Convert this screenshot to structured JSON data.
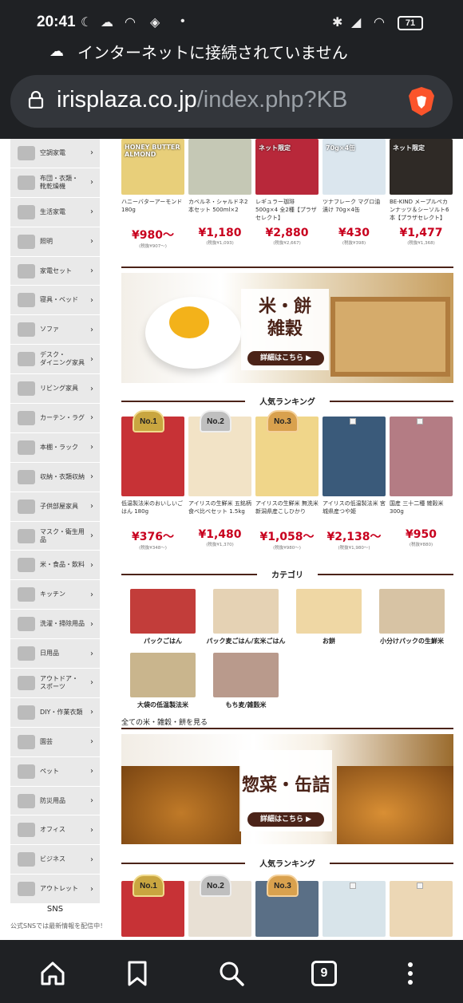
{
  "status_bar": {
    "time": "20:41",
    "dot": "•",
    "battery": "71"
  },
  "offline_banner": {
    "text": "インターネットに接続されていません"
  },
  "address_bar": {
    "domain": "irisplaza.co.jp",
    "path": "/index.php?KB"
  },
  "sidebar": {
    "items": [
      {
        "label": "空調家電"
      },
      {
        "label": "布団・衣類・\n靴乾燥機"
      },
      {
        "label": "生活家電"
      },
      {
        "label": "照明"
      },
      {
        "label": "家電セット"
      },
      {
        "label": "寝具・ベッド"
      },
      {
        "label": "ソファ"
      },
      {
        "label": "デスク・\nダイニング家具"
      },
      {
        "label": "リビング家具"
      },
      {
        "label": "カーテン・ラグ"
      },
      {
        "label": "本棚・ラック"
      },
      {
        "label": "収納・衣類収納"
      },
      {
        "label": "子供部屋家具"
      },
      {
        "label": "マスク・衛生用品"
      },
      {
        "label": "米・食品・飲料"
      },
      {
        "label": "キッチン"
      },
      {
        "label": "洗濯・掃除用品"
      },
      {
        "label": "日用品"
      },
      {
        "label": "アウトドア・\nスポーツ"
      },
      {
        "label": "DIY・作業衣類"
      },
      {
        "label": "園芸"
      },
      {
        "label": "ペット"
      },
      {
        "label": "防災用品"
      },
      {
        "label": "オフィス"
      },
      {
        "label": "ビジネス"
      },
      {
        "label": "アウトレット"
      }
    ],
    "arrow": "›"
  },
  "sns": {
    "title": "SNS",
    "subtitle": "公式SNSでは最新情報を配信中！"
  },
  "top_products": [
    {
      "name": "ハニーバターアーモンド 180g",
      "price": "¥980〜",
      "tax": "(税抜¥907〜)",
      "img_text": "HONEY BUTTER ALMOND"
    },
    {
      "name": "カベルネ・シャルドネ2本セット 500ml×2",
      "price": "¥1,180",
      "tax": "(税抜¥1,093)",
      "img_text": ""
    },
    {
      "name": "レギュラー珈琲 500g×4 全2種【プラザセレクト】",
      "price": "¥2,880",
      "tax": "(税抜¥2,667)",
      "img_text": "ネット限定"
    },
    {
      "name": "ツナフレーク マグロ油漬け 70g×4缶",
      "price": "¥430",
      "tax": "(税抜¥398)",
      "img_text": "70g×4缶"
    },
    {
      "name": "BE-KIND メープルペカンナッツ＆シーソルト6本【プラザセレクト】",
      "price": "¥1,477",
      "tax": "(税抜¥1,368)",
      "img_text": "ネット限定"
    }
  ],
  "rice_banner": {
    "title": "米・餅\n雑穀",
    "button": "詳細はこちら ▶"
  },
  "ranking1": {
    "title": "人気ランキング",
    "items": [
      {
        "badge": "No.1",
        "name": "低温製法米のおいしいごはん 180g",
        "price": "¥376〜",
        "tax": "(税抜¥348〜)"
      },
      {
        "badge": "No.2",
        "name": "アイリスの生鮮米 五銘柄食べ比べセット 1.5kg",
        "price": "¥1,480",
        "tax": "(税抜¥1,370)"
      },
      {
        "badge": "No.3",
        "name": "アイリスの生鮮米 無洗米 新潟県産こしひかり",
        "price": "¥1,058〜",
        "tax": "(税抜¥980〜)"
      },
      {
        "badge": "",
        "name": "アイリスの低温製法米 宮城県産つや姫",
        "price": "¥2,138〜",
        "tax": "(税抜¥1,980〜)"
      },
      {
        "badge": "",
        "name": "国産 三十二種 雑穀米300g",
        "price": "¥950",
        "tax": "(税抜¥880)"
      }
    ]
  },
  "category": {
    "title": "カテゴリ",
    "items": [
      {
        "name": "パックごはん"
      },
      {
        "name": "パック麦ごはん/玄米ごはん"
      },
      {
        "name": "お餅"
      },
      {
        "name": "小分けパックの生鮮米"
      },
      {
        "name": "大袋の低温製法米"
      },
      {
        "name": "もち麦/雑穀米"
      }
    ],
    "see_all": "全ての米・雑穀・餅を見る"
  },
  "sozai_banner": {
    "title": "惣菜・缶詰",
    "button": "詳細はこちら ▶"
  },
  "ranking2": {
    "title": "人気ランキング",
    "badges": [
      "No.1",
      "No.2",
      "No.3"
    ]
  },
  "colors": {
    "accent": "#c8001e",
    "brand_brown": "#4b2318",
    "chrome": "#1f2124"
  }
}
